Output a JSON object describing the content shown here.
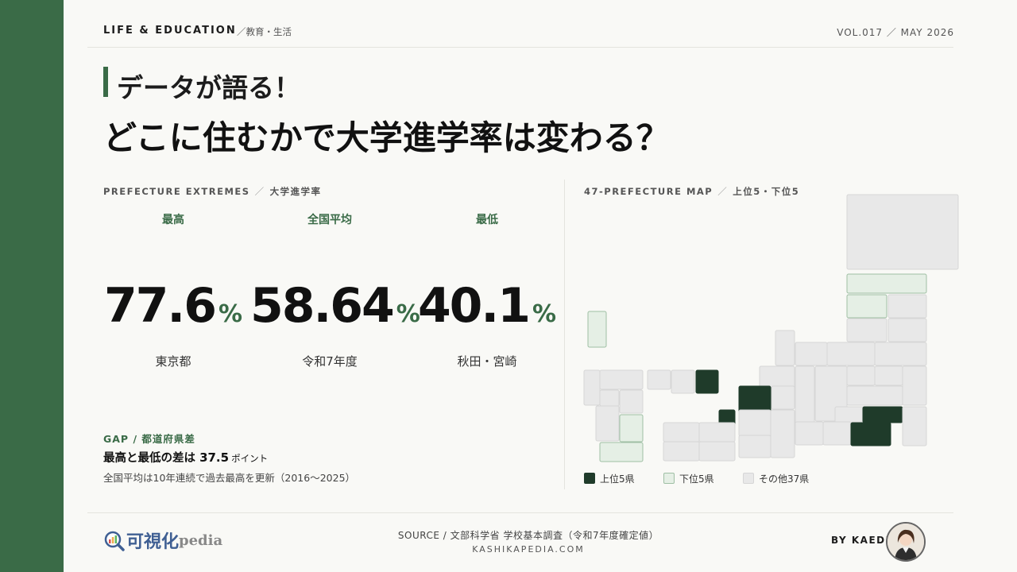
{
  "header": {
    "category": "LIFE & EDUCATION",
    "subcategory": "／教育・生活",
    "volume": "VOL.017 ／ MAY 2026"
  },
  "title": {
    "line1": "データが語る！",
    "line2": "どこに住むかで大学進学率は変わる？"
  },
  "extremes": {
    "label": "PREFECTURE EXTREMES",
    "label_sub": "大学進学率",
    "stats": [
      {
        "head": "最高",
        "value": "77.6",
        "unit": "%",
        "foot": "東京都"
      },
      {
        "head": "全国平均",
        "value": "58.64",
        "unit": "%",
        "foot": "令和7年度"
      },
      {
        "head": "最低",
        "value": "40.1",
        "unit": "%",
        "foot": "秋田・宮崎"
      }
    ]
  },
  "gap": {
    "label": "GAP / 都道府県差",
    "main_prefix": "最高と最低の差は",
    "value": "37.5",
    "unit": "ポイント",
    "note": "全国平均は10年連続で過去最高を更新（2016〜2025）"
  },
  "map": {
    "label": "47-PREFECTURE MAP",
    "label_sub": "上位5・下位5",
    "colors": {
      "top": "#1f3b2a",
      "bottom": "#e5efe5",
      "other": "#e8e8e8",
      "bottom_stroke": "#9fbfa4",
      "other_stroke": "#d6d6d6"
    },
    "legend": [
      {
        "label": "上位5県",
        "color": "#1f3b2a"
      },
      {
        "label": "下位5県",
        "color": "#e5efe5"
      },
      {
        "label": "その他37県",
        "color": "#e8e8e8"
      }
    ]
  },
  "footer": {
    "logo_main": "可視化",
    "logo_sub": "pedia",
    "source": "SOURCE / 文部科学省 学校基本調査（令和7年度確定値）",
    "site": "KASHIKAPEDIA.COM",
    "byline": "BY KAEDE",
    "avatar_icon": "author-avatar-icon"
  }
}
